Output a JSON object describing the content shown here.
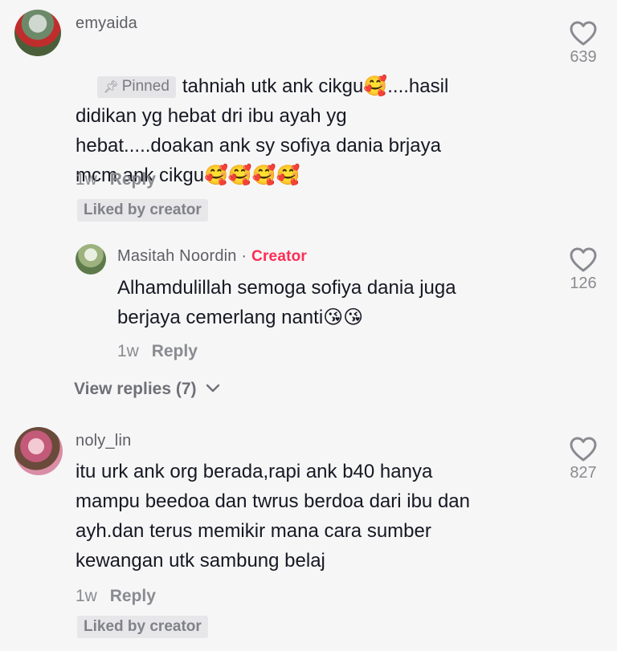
{
  "comments": [
    {
      "username": "emyaida",
      "pinned_label": "Pinned",
      "text_lines": [
        "tahniah utk ank cikgu🥰....hasil",
        "didikan yg hebat dri ibu ayah yg",
        "hebat.....doakan ank sy sofiya dania brjaya",
        "mcm ank cikgu🥰🥰🥰🥰"
      ],
      "time": "1w",
      "reply_label": "Reply",
      "liked_label": "Liked by creator",
      "likes": "639"
    },
    {
      "username": "Masitah Noordin",
      "creator_label": "Creator",
      "text_lines": [
        "Alhamdulillah semoga sofiya dania juga",
        "berjaya cemerlang nanti😘😘"
      ],
      "time": "1w",
      "reply_label": "Reply",
      "likes": "126"
    },
    {
      "username": "noly_lin",
      "text_lines": [
        "itu urk ank org berada,rapi ank b40 hanya",
        "mampu beedoa dan twrus berdoa dari ibu dan",
        "ayh.dan terus memikir mana cara sumber",
        "kewangan utk sambung belaj"
      ],
      "time": "1w",
      "reply_label": "Reply",
      "liked_label": "Liked by creator",
      "likes": "827"
    }
  ],
  "view_replies_label": "View replies (7)",
  "icons": {
    "heart": "heart-outline-icon",
    "pin": "pin-icon",
    "chevron": "chevron-down-icon"
  },
  "colors": {
    "creator": "#fe2c55",
    "muted": "#8a8b91",
    "background": "#f6f6f6"
  }
}
